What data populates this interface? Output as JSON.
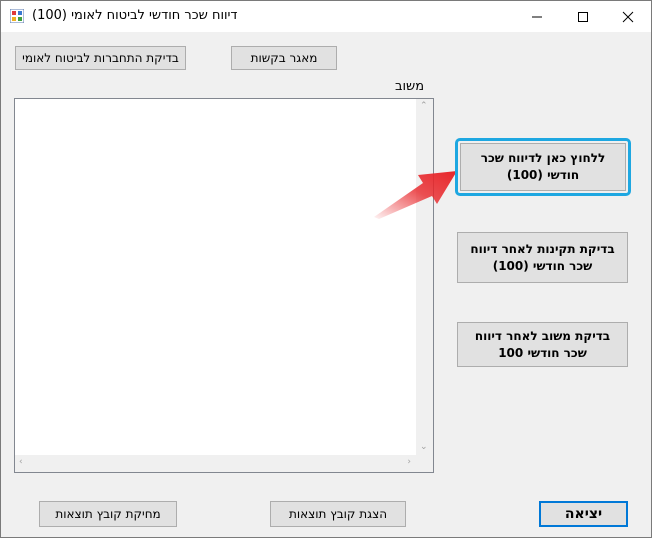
{
  "window": {
    "title": "דיווח שכר חודשי לביטוח לאומי (100)",
    "minimize_glyph": "—",
    "maximize_glyph": "☐",
    "close_glyph": "✕"
  },
  "toolbar": {
    "check_connection_label": "בדיקת התחברות לביטוח לאומי",
    "contacts_label": "מאגר בקשות"
  },
  "feedback": {
    "label": "משוב",
    "content": ""
  },
  "actions": {
    "report_label": "ללחוץ כאן לדיווח שכר חודשי (100)",
    "check_validity_label": "בדיקת תקינות לאחר דיווח שכר חודשי (100)",
    "check_feedback_label": "בדיקת משוב לאחר דיווח שכר חודשי 100"
  },
  "footer": {
    "delete_results_label": "מחיקת קובץ תוצאות",
    "show_results_label": "הצגת קובץ תוצאות",
    "exit_label": "יציאה"
  },
  "colors": {
    "highlight_border": "#1ea7e1",
    "arrow": "#e8262a",
    "exit_border": "#0078d7"
  }
}
